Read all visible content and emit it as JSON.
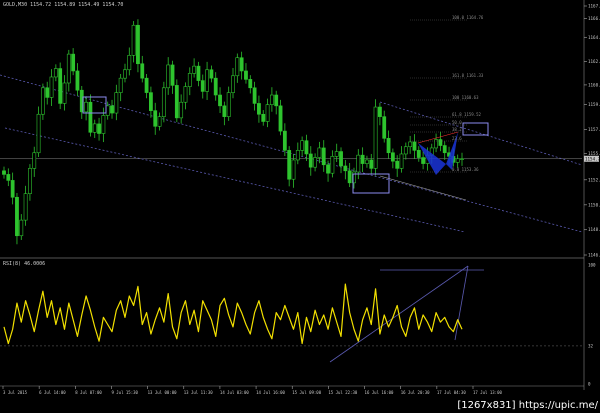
{
  "app": {
    "symbol_label": "GOLD,M30",
    "quote": "1154.72 1154.89 1154.49 1154.70",
    "indicator_label": "RSI(8) 46.0006"
  },
  "colors": {
    "background": "#000000",
    "bull_candle": "#2ec42e",
    "bear_candle": "#2ec42e",
    "rsi_line": "#f2e000",
    "trend_line": "#5a5ab0",
    "box": "#8c8cf0",
    "pattern_fill": "#1a34d8",
    "price_marker": "#c8c8c8"
  },
  "watermark": "[1267x831] https://upic.me/",
  "chart_data": [
    {
      "type": "candlestick",
      "title": "GOLD,M30",
      "ylim": [
        1146.7,
        1167.4
      ],
      "y_ticks": [
        1146.7,
        1148.8,
        1150.87,
        1152.95,
        1155.15,
        1157.15,
        1159.2,
        1160.84,
        1162.8,
        1164.8,
        1166.35,
        1167.4
      ],
      "y_tick_labels": [
        "1146.70",
        "1148.80",
        "1150.87",
        "1152.95",
        "1155.15",
        "1157.15",
        "1159.20",
        "1160.84",
        "1162.80",
        "1164.80",
        "1166.35",
        "1167.40"
      ],
      "current_price": 1154.7,
      "current_price_label": "1154.70",
      "x_tick_labels": [
        "3 Jul 2015",
        "6 Jul 14:00",
        "8 Jul 07:00",
        "9 Jul 15:30",
        "13 Jul 00:00",
        "13 Jul 11:30",
        "14 Jul 03:00",
        "14 Jul 16:00",
        "15 Jul 09:00",
        "15 Jul 22:30",
        "16 Jul 16:00",
        "16 Jul 20:30",
        "17 Jul 04:30",
        "17 Jul 13:00"
      ],
      "fib_levels": [
        "100.0 1164.76",
        "161.8 1161.33",
        "100 1160.63",
        "61.8 1159.52",
        "50.0",
        "38.2",
        "23.6",
        "0.0 1153.36"
      ],
      "close": [
        1153.4,
        1152.9,
        1151.5,
        1148.3,
        1149.6,
        1151.8,
        1153.9,
        1155.2,
        1158.4,
        1160.6,
        1159.8,
        1161.5,
        1162.2,
        1159.3,
        1161.0,
        1163.4,
        1162.0,
        1160.4,
        1158.6,
        1159.4,
        1156.9,
        1157.6,
        1156.8,
        1158.3,
        1159.1,
        1158.5,
        1160.2,
        1161.4,
        1162.1,
        1163.3,
        1165.8,
        1162.6,
        1161.4,
        1160.2,
        1158.7,
        1157.4,
        1158.2,
        1160.6,
        1162.5,
        1160.8,
        1158.1,
        1159.4,
        1160.7,
        1161.8,
        1162.4,
        1161.2,
        1160.3,
        1162.1,
        1161.4,
        1160.0,
        1159.1,
        1158.2,
        1160.2,
        1161.6,
        1163.1,
        1162.0,
        1161.3,
        1160.6,
        1159.3,
        1158.4,
        1157.8,
        1159.2,
        1160.0,
        1159.1,
        1157.0,
        1155.4,
        1153.0,
        1154.6,
        1155.4,
        1156.2,
        1155.1,
        1154.0,
        1154.8,
        1155.6,
        1154.2,
        1153.5,
        1154.9,
        1155.3,
        1154.1,
        1153.7,
        1152.7,
        1153.6,
        1155.0,
        1154.3,
        1154.6,
        1153.9,
        1159.0,
        1158.2,
        1156.4,
        1155.2,
        1154.5,
        1153.9,
        1155.1,
        1155.7,
        1156.1,
        1155.4,
        1154.8,
        1154.3,
        1155.0,
        1155.6,
        1156.3,
        1155.8,
        1155.2,
        1154.9,
        1154.4,
        1154.7,
        1154.7
      ]
    },
    {
      "type": "line",
      "title": "RSI(8) 46.0006",
      "ylim": [
        0,
        100
      ],
      "y_tick_labels": [
        "100",
        "32",
        "0"
      ],
      "levels": [
        32
      ],
      "values": [
        48,
        34,
        46,
        68,
        52,
        70,
        58,
        44,
        62,
        78,
        56,
        70,
        50,
        64,
        46,
        68,
        54,
        40,
        58,
        74,
        62,
        48,
        36,
        56,
        50,
        44,
        62,
        70,
        56,
        74,
        66,
        82,
        50,
        60,
        42,
        54,
        64,
        52,
        76,
        48,
        38,
        60,
        70,
        50,
        62,
        44,
        70,
        62,
        54,
        40,
        66,
        72,
        58,
        48,
        68,
        60,
        50,
        42,
        60,
        70,
        56,
        46,
        38,
        60,
        54,
        66,
        56,
        46,
        60,
        34,
        56,
        44,
        62,
        50,
        58,
        46,
        64,
        52,
        40,
        84,
        60,
        46,
        36,
        54,
        64,
        50,
        80,
        42,
        58,
        48,
        56,
        66,
        48,
        40,
        56,
        64,
        46,
        58,
        52,
        44,
        60,
        52,
        56,
        48,
        44,
        54,
        46
      ]
    }
  ]
}
